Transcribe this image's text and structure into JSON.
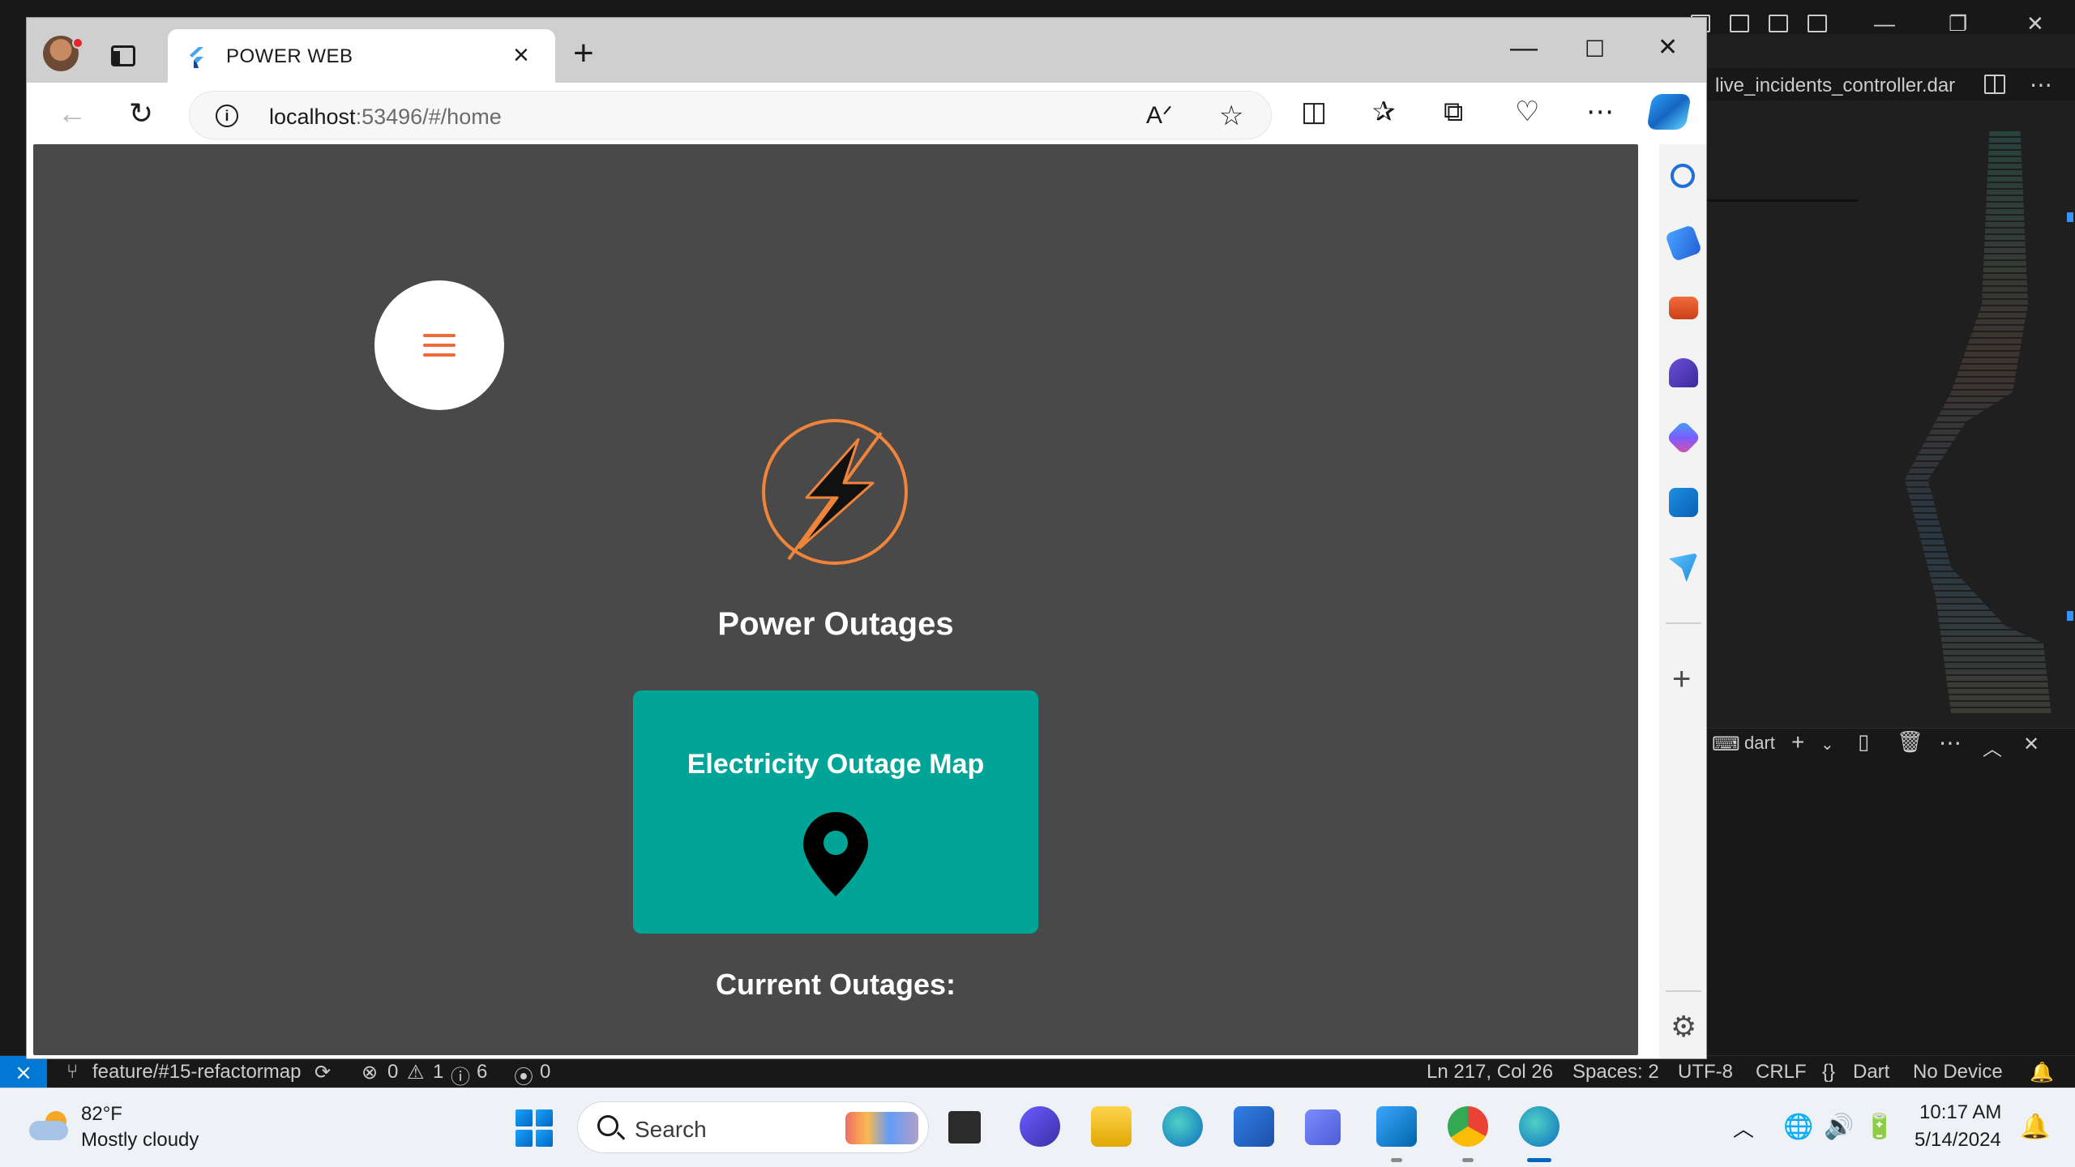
{
  "browser": {
    "tab_title": "POWER WEB",
    "url_host": "localhost",
    "url_rest": ":53496/#/home",
    "accent": "#00a598"
  },
  "page": {
    "title": "Power Outages",
    "map_card_label": "Electricity Outage Map",
    "current_outages_heading": "Current Outages:",
    "background": "#494949",
    "menu_accent": "#ee6a3a"
  },
  "vscode": {
    "editor_tab": "live_incidents_controller.dar",
    "terminal_label": "dart",
    "status": {
      "branch": "feature/#15-refactormap",
      "errors": "0",
      "warnings": "1",
      "infos": "6",
      "ports": "0",
      "cursor": "Ln 217, Col 26",
      "spaces": "Spaces: 2",
      "encoding": "UTF-8",
      "eol": "CRLF",
      "language": "Dart",
      "device": "No Device"
    }
  },
  "taskbar": {
    "weather_temp": "82°F",
    "weather_desc": "Mostly cloudy",
    "search_label": "Search",
    "time": "10:17 AM",
    "date": "5/14/2024"
  }
}
